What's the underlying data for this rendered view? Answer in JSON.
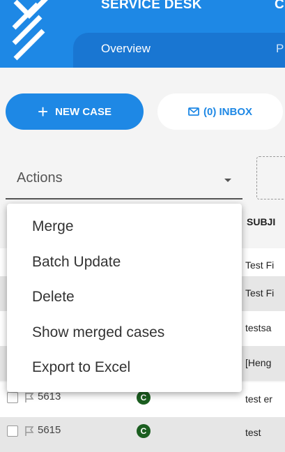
{
  "header": {
    "app_title": "SERVICE DESK",
    "app_title_next": "C",
    "tabs": [
      {
        "label": "Overview"
      },
      {
        "label": "P"
      }
    ]
  },
  "toolbar": {
    "new_case_label": "NEW CASE",
    "inbox_label": "(0) INBOX"
  },
  "actions": {
    "select_label": "Actions",
    "menu_items": [
      {
        "label": "Merge"
      },
      {
        "label": "Batch Update"
      },
      {
        "label": "Delete"
      },
      {
        "label": "Show merged cases"
      },
      {
        "label": "Export to Excel"
      }
    ]
  },
  "table": {
    "subject_header": "SUBJI",
    "rows": [
      {
        "subject": "Test Fi"
      },
      {
        "subject": "Test Fi"
      },
      {
        "subject": "testsa"
      },
      {
        "subject": "[Heng"
      },
      {
        "id": "5613",
        "status": "C",
        "subject": "test er"
      },
      {
        "id": "5615",
        "status": "C",
        "subject": "test"
      }
    ]
  },
  "colors": {
    "header_blue": "#1e88e5",
    "tab_blue": "#1976d2",
    "status_green": "#1b5e20"
  }
}
